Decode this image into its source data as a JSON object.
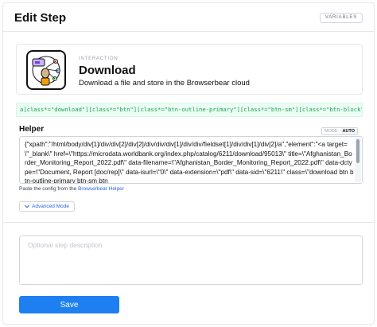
{
  "header": {
    "title": "Edit Step",
    "variables_label": "VARIABLES"
  },
  "action_card": {
    "kicker": "INTERACTION",
    "title": "Download",
    "description": "Download a file and store in the Browserbear cloud",
    "icon": "download-illustration-icon"
  },
  "selector": {
    "value": "a[class*=\"download\"][class*=\"btn\"][class*=\"btn-outline-primary\"][class*=\"btn-sm\"][class*=\"btn-block\"]"
  },
  "helper": {
    "label": "Helper",
    "mode_off": "MODE",
    "mode_on": "AUTO",
    "value": "{\"xpath\":\"/html/body/div[1]/div/div[2]/div[2]/div/div/div[1]/div/div/fieldset[1]/div/div[1]/div[2]/a\",\"element\":\"<a target=\\\"_blank\\\" href=\\\"https://microdata.worldbank.org/index.php/catalog/6211/download/95013\\\" title=\\\"Afghanistan_Border_Monitoring_Report_2022.pdf\\\" data-filename=\\\"Afghanistan_Border_Monitoring_Report_2022.pdf\\\" data-dctype=\\\"Document, Report [doc/rep]\\\" data-isurl=\\\"0\\\" data-extension=\\\"pdf\\\" data-sid=\\\"6211\\\" class=\\\"download btn btn-outline-primary btn-sm btn",
    "paste_hint_prefix": "Paste the config from the",
    "paste_hint_link": "Browserbear Helper"
  },
  "advanced_mode": {
    "label": "Advanced Mode"
  },
  "step_description": {
    "placeholder": "Optional step description"
  },
  "save": {
    "label": "Save"
  },
  "colors": {
    "primary": "#1e7ff0",
    "link": "#2563eb",
    "selector_text": "#16a34a",
    "selector_bg": "#ecfdf5"
  }
}
